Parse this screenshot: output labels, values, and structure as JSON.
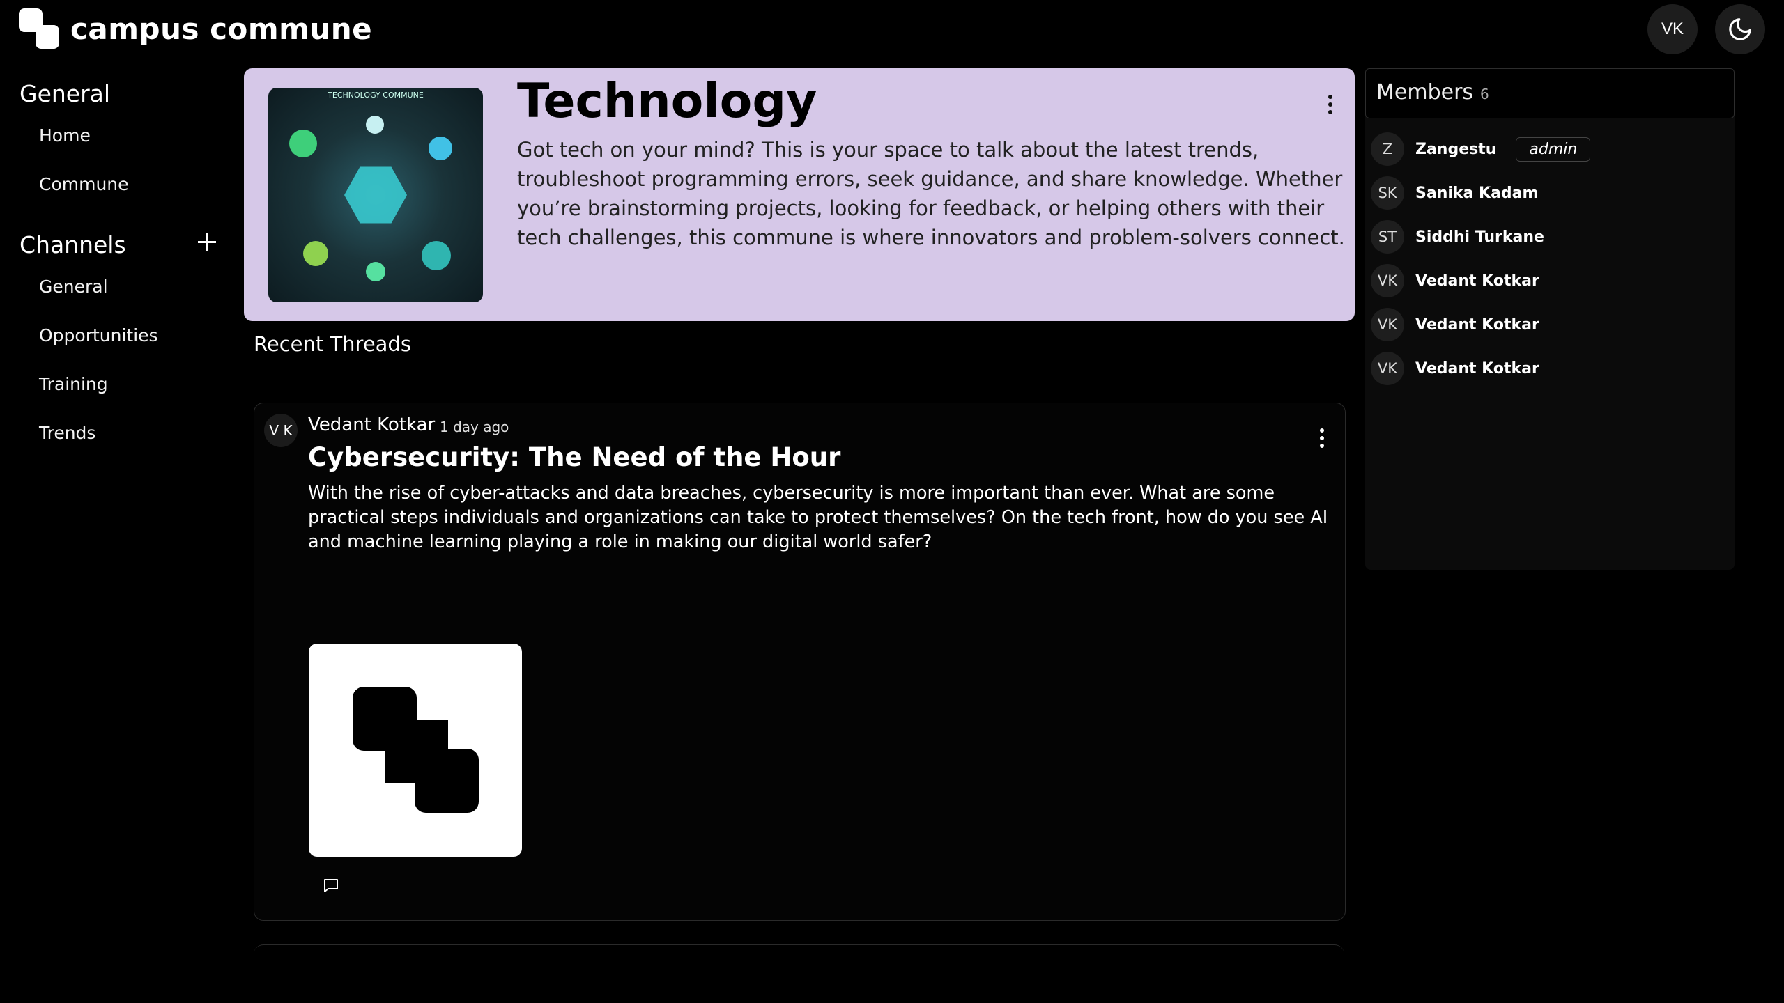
{
  "header": {
    "app_name": "campus commune",
    "user_initials": "VK"
  },
  "sidebar": {
    "general_heading": "General",
    "general_items": [
      {
        "label": "Home"
      },
      {
        "label": "Commune"
      }
    ],
    "channels_heading": "Channels",
    "channel_items": [
      {
        "label": "General"
      },
      {
        "label": "Opportunities"
      },
      {
        "label": "Training"
      },
      {
        "label": "Trends"
      }
    ]
  },
  "commune": {
    "title": "Technology",
    "description": "Got tech on your mind? This is your space to talk about the latest trends, troubleshoot programming errors, seek guidance, and share knowledge. Whether you’re brainstorming projects, looking for feedback, or helping others with their tech challenges, this commune is where innovators and problem-solvers connect.",
    "image_caption": "TECHNOLOGY COMMUNE"
  },
  "threads": {
    "heading": "Recent Threads",
    "items": [
      {
        "avatar": "V K",
        "author": "Vedant Kotkar",
        "time": "1 day ago",
        "title": "Cybersecurity: The Need of the Hour",
        "body": "With the rise of cyber-attacks and data breaches, cybersecurity is more important than ever. What are some practical steps individuals and organizations can take to protect themselves? On the tech front, how do you see AI and machine learning playing a role in making our digital world safer?"
      }
    ]
  },
  "members": {
    "title": "Members",
    "count": "6",
    "admin_label": "admin",
    "list": [
      {
        "initials": "Z",
        "name": "Zangestu"
      },
      {
        "initials": "SK",
        "name": "Sanika Kadam"
      },
      {
        "initials": "ST",
        "name": "Siddhi Turkane"
      },
      {
        "initials": "VK",
        "name": "Vedant Kotkar"
      },
      {
        "initials": "VK",
        "name": "Vedant Kotkar"
      },
      {
        "initials": "VK",
        "name": "Vedant Kotkar"
      }
    ]
  },
  "icons": {
    "logo": "campus-commune-logo",
    "theme_toggle": "moon-icon",
    "add_channel": "plus-icon",
    "more": "vertical-dots-icon",
    "comment": "comment-icon"
  }
}
